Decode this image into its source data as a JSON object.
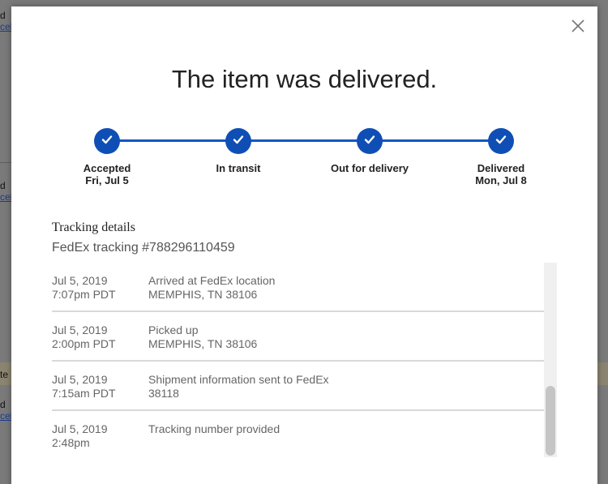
{
  "background": {
    "fragments": [
      {
        "line1": "d",
        "line2": "cel"
      },
      {
        "line1": "d",
        "line2": "cel"
      },
      {
        "line1": "d",
        "line2": "cel"
      }
    ],
    "band_text": "te"
  },
  "modal": {
    "close_icon": "close-x-icon",
    "title": "The item was delivered.",
    "accent_color": "#0f4fb5",
    "steps": [
      {
        "label": "Accepted",
        "date": "Fri, Jul 5",
        "status": "complete"
      },
      {
        "label": "In transit",
        "date": "",
        "status": "complete"
      },
      {
        "label": "Out for delivery",
        "date": "",
        "status": "complete"
      },
      {
        "label": "Delivered",
        "date": "Mon, Jul 8",
        "status": "complete"
      }
    ],
    "details_title": "Tracking details",
    "tracking_line": "FedEx tracking #788296110459",
    "events": [
      {
        "date": "Jul 5, 2019",
        "time": "7:07pm PDT",
        "description": "Arrived at FedEx location",
        "location": "MEMPHIS, TN 38106"
      },
      {
        "date": "Jul 5, 2019",
        "time": "2:00pm PDT",
        "description": "Picked up",
        "location": "MEMPHIS, TN 38106"
      },
      {
        "date": "Jul 5, 2019",
        "time": "7:15am PDT",
        "description": "Shipment information sent to FedEx",
        "location": "38118"
      },
      {
        "date": "Jul 5, 2019",
        "time": "2:48pm",
        "description": "Tracking number provided",
        "location": ""
      }
    ]
  }
}
